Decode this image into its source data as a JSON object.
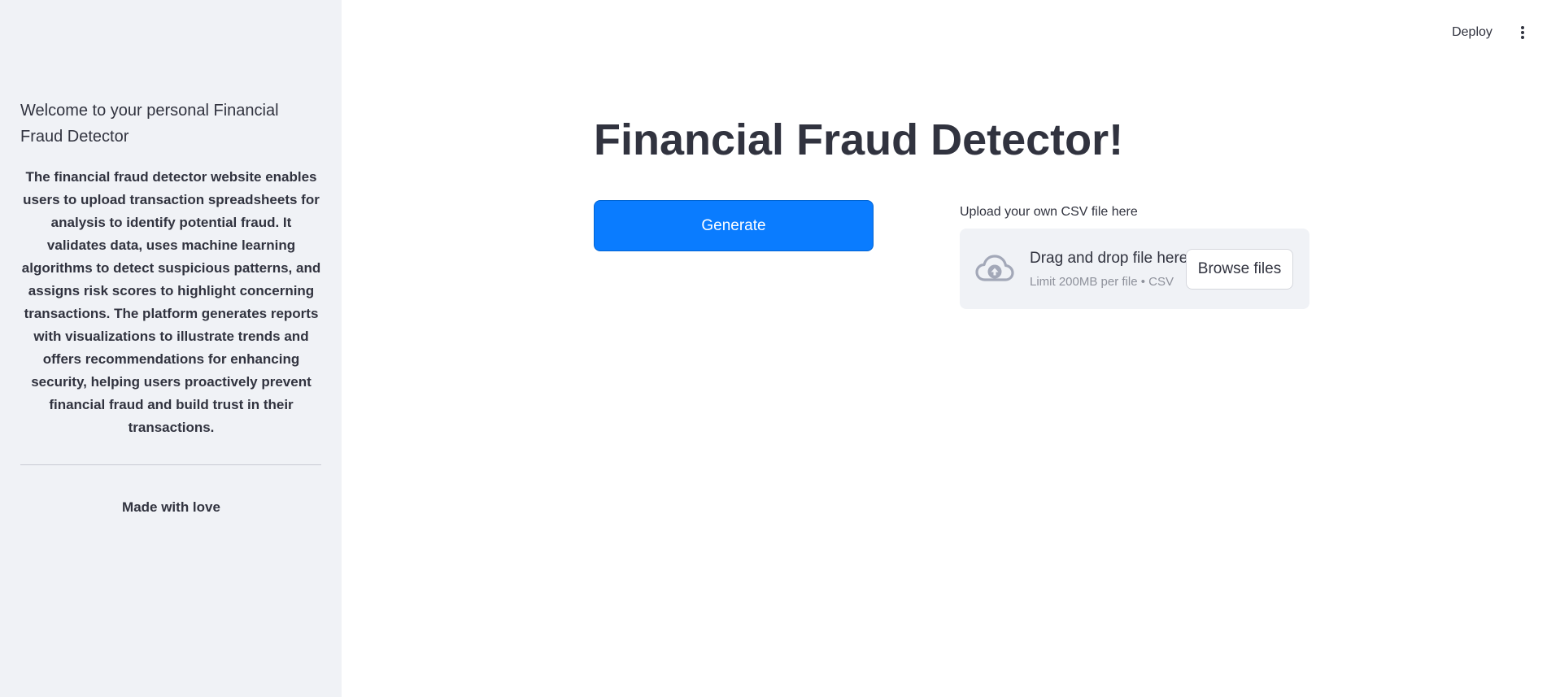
{
  "sidebar": {
    "heading": "Welcome to your personal Financial Fraud Detector",
    "description": "The financial fraud detector website enables users to upload transaction spreadsheets for analysis to identify potential fraud. It validates data, uses machine learning algorithms to detect suspicious patterns, and assigns risk scores to highlight concerning transactions. The platform generates reports with visualizations to illustrate trends and offers recommendations for enhancing security, helping users proactively prevent financial fraud and build trust in their transactions.",
    "footer": "Made with love"
  },
  "topbar": {
    "deploy_label": "Deploy",
    "menu_icon": "more-vertical-icon"
  },
  "main": {
    "title": "Financial Fraud Detector!",
    "generate_label": "Generate",
    "uploader": {
      "label": "Upload your own CSV file here",
      "drop_text": "Drag and drop file here",
      "limit_text": "Limit 200MB per file • CSV",
      "browse_label": "Browse files",
      "icon": "cloud-upload-icon"
    }
  },
  "colors": {
    "sidebar_bg": "#f0f2f6",
    "primary_button": "#0a7cff",
    "text": "#31333f",
    "muted_text": "#8e919b"
  }
}
